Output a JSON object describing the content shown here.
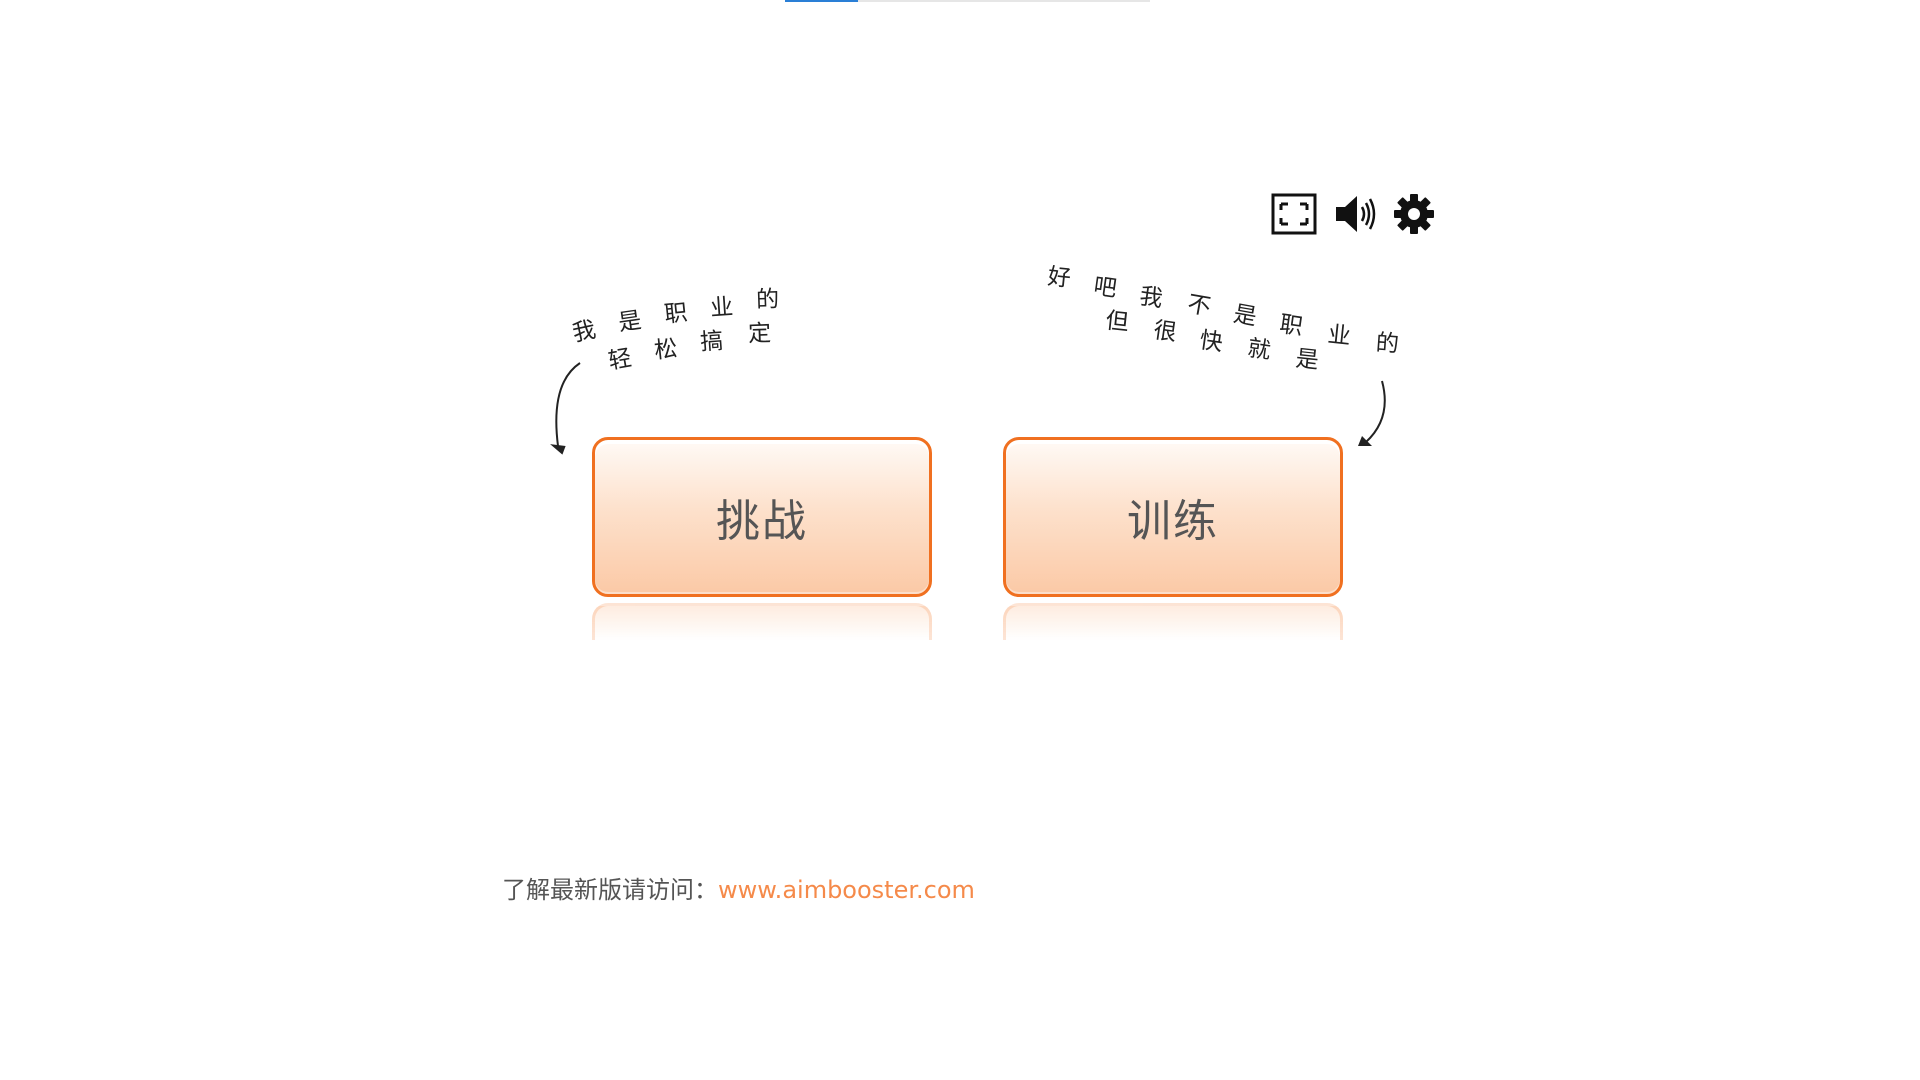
{
  "progress": {
    "fraction": 0.2,
    "fill_color": "#2a7fd6"
  },
  "toolbar": {
    "fullscreen_icon": "fullscreen-icon",
    "sound_icon": "speaker-icon",
    "settings_icon": "gear-icon"
  },
  "annotations": {
    "left": [
      "我",
      "是",
      "职",
      "业",
      "的",
      "轻",
      "松",
      "搞",
      "定"
    ],
    "right": [
      "好",
      "吧",
      "我",
      "不",
      "是",
      "职",
      "业",
      "的",
      "但",
      "很",
      "快",
      "就",
      "是"
    ]
  },
  "buttons": {
    "challenge_label": "挑战",
    "train_label": "训练",
    "accent_color": "#f07020"
  },
  "footer": {
    "prefix": "了解最新版请访问：",
    "link_text": "www.aimbooster.com",
    "link_color": "#f58a4a"
  }
}
